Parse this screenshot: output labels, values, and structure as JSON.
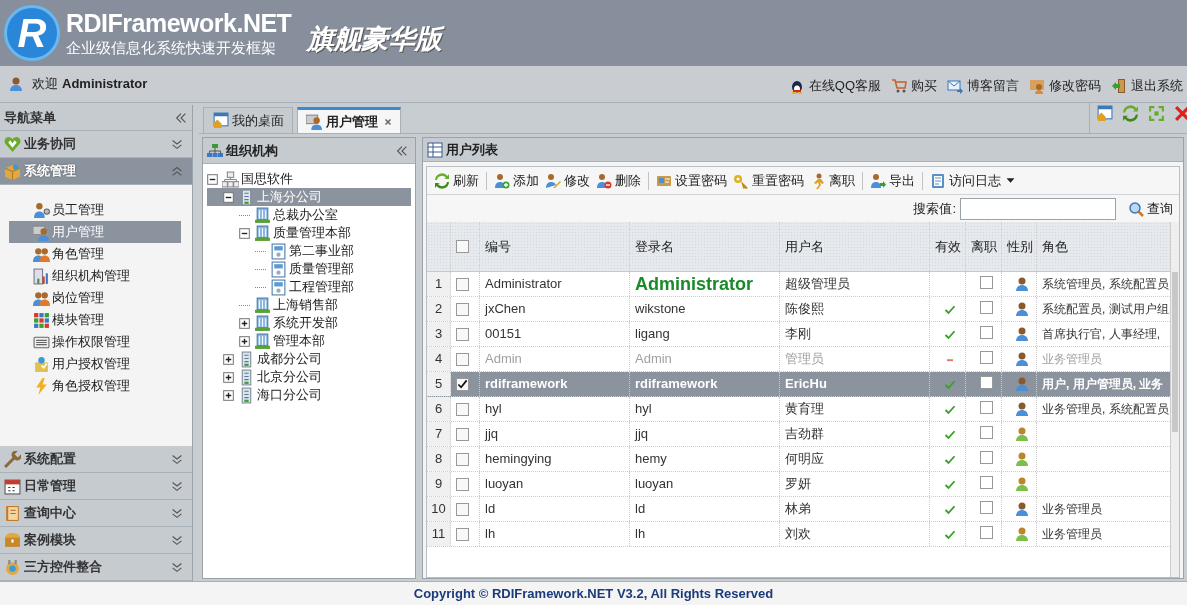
{
  "header": {
    "logo_letter": "R",
    "title": "RDIFramework.NET",
    "subtitle": "企业级信息化系统快速开发框架",
    "edition": "旗舰豪华版"
  },
  "user_bar": {
    "welcome": "欢迎",
    "user": "Administrator",
    "links": [
      "在线QQ客服",
      "购买",
      "博客留言",
      "修改密码",
      "退出系统"
    ]
  },
  "nav": {
    "title": "导航菜单",
    "sections": [
      {
        "label": "业务协同",
        "expanded": false
      },
      {
        "label": "系统管理",
        "expanded": true,
        "items": [
          {
            "label": "员工管理",
            "selected": false
          },
          {
            "label": "用户管理",
            "selected": true
          },
          {
            "label": "角色管理",
            "selected": false
          },
          {
            "label": "组织机构管理",
            "selected": false
          },
          {
            "label": "岗位管理",
            "selected": false
          },
          {
            "label": "模块管理",
            "selected": false
          },
          {
            "label": "操作权限管理",
            "selected": false
          },
          {
            "label": "用户授权管理",
            "selected": false
          },
          {
            "label": "角色授权管理",
            "selected": false
          }
        ]
      },
      {
        "label": "系统配置",
        "expanded": false
      },
      {
        "label": "日常管理",
        "expanded": false
      },
      {
        "label": "查询中心",
        "expanded": false
      },
      {
        "label": "案例模块",
        "expanded": false
      },
      {
        "label": "三方控件整合",
        "expanded": false
      }
    ]
  },
  "tabs": [
    {
      "label": "我的桌面",
      "selected": false,
      "closable": false
    },
    {
      "label": "用户管理",
      "selected": true,
      "closable": true
    }
  ],
  "org_panel": {
    "title": "组织机构",
    "tree": [
      {
        "label": "国思软件",
        "kind": "root",
        "expanded": true,
        "selected": false,
        "children": [
          {
            "label": "上海分公司",
            "kind": "company",
            "expanded": true,
            "selected": true,
            "children": [
              {
                "label": "总裁办公室",
                "kind": "dept",
                "selected": false
              },
              {
                "label": "质量管理本部",
                "kind": "dept",
                "expanded": true,
                "selected": false,
                "children": [
                  {
                    "label": "第二事业部",
                    "kind": "unit",
                    "selected": false
                  },
                  {
                    "label": "质量管理部",
                    "kind": "unit",
                    "selected": false
                  },
                  {
                    "label": "工程管理部",
                    "kind": "unit",
                    "selected": false
                  }
                ]
              },
              {
                "label": "上海销售部",
                "kind": "dept",
                "selected": false
              },
              {
                "label": "系统开发部",
                "kind": "dept",
                "expanded": false,
                "selected": false
              },
              {
                "label": "管理本部",
                "kind": "dept",
                "expanded": false,
                "selected": false
              }
            ]
          },
          {
            "label": "成都分公司",
            "kind": "company",
            "expanded": false,
            "selected": false
          },
          {
            "label": "北京分公司",
            "kind": "company",
            "expanded": false,
            "selected": false
          },
          {
            "label": "海口分公司",
            "kind": "company",
            "expanded": false,
            "selected": false
          }
        ]
      }
    ]
  },
  "user_panel": {
    "title": "用户列表",
    "toolbar": [
      [
        {
          "label": "刷新"
        }
      ],
      [
        {
          "label": "添加"
        },
        {
          "label": "修改"
        },
        {
          "label": "删除"
        }
      ],
      [
        {
          "label": "设置密码"
        },
        {
          "label": "重置密码"
        },
        {
          "label": "离职"
        }
      ],
      [
        {
          "label": "导出"
        }
      ],
      [
        {
          "label": "访问日志",
          "has_menu": true
        }
      ]
    ],
    "search": {
      "label": "搜索值:",
      "button": "查询"
    },
    "columns": [
      "编号",
      "登录名",
      "用户名",
      "有效",
      "离职",
      "性别",
      "角色"
    ],
    "header_checked": false,
    "rows": [
      {
        "num": "1",
        "code": "Administrator",
        "login": "Administrator",
        "name": "超级管理员",
        "resigned": false,
        "female": false,
        "roles": "系统管理员, 系统配置员",
        "selected": false,
        "disabled": false,
        "emphasized": true
      },
      {
        "num": "2",
        "code": "jxChen",
        "login": "wikstone",
        "name": "陈俊熙",
        "valid": true,
        "resigned": false,
        "female": false,
        "roles": "系统配置员, 测试用户组,",
        "selected": false,
        "disabled": false,
        "emphasized": false
      },
      {
        "num": "3",
        "code": "00151",
        "login": "ligang",
        "name": "李刚",
        "valid": true,
        "resigned": false,
        "female": false,
        "roles": "首席执行官, 人事经理,",
        "selected": false,
        "disabled": false,
        "emphasized": false
      },
      {
        "num": "4",
        "code": "Admin",
        "login": "Admin",
        "name": "管理员",
        "valid": false,
        "resigned": false,
        "female": false,
        "roles": "业务管理员",
        "selected": false,
        "disabled": true,
        "emphasized": false
      },
      {
        "num": "5",
        "code": "rdiframework",
        "login": "rdiframework",
        "name": "EricHu",
        "valid": true,
        "resigned": false,
        "female": false,
        "roles": "用户, 用户管理员, 业务",
        "selected": true,
        "disabled": false,
        "emphasized": false
      },
      {
        "num": "6",
        "code": "hyl",
        "login": "hyl",
        "name": "黄育理",
        "valid": true,
        "resigned": false,
        "female": false,
        "roles": "业务管理员, 系统配置员",
        "selected": false,
        "disabled": false,
        "emphasized": false
      },
      {
        "num": "7",
        "code": "jjq",
        "login": "jjq",
        "name": "吉劲群",
        "valid": true,
        "resigned": false,
        "female": true,
        "selected": false,
        "disabled": false,
        "emphasized": false
      },
      {
        "num": "8",
        "code": "hemingying",
        "login": "hemy",
        "name": "何明应",
        "valid": true,
        "resigned": false,
        "female": true,
        "selected": false,
        "disabled": false,
        "emphasized": false
      },
      {
        "num": "9",
        "code": "luoyan",
        "login": "luoyan",
        "name": "罗妍",
        "valid": true,
        "resigned": false,
        "female": true,
        "selected": false,
        "disabled": false,
        "emphasized": false
      },
      {
        "num": "10",
        "code": "ld",
        "login": "ld",
        "name": "林弟",
        "valid": true,
        "resigned": false,
        "female": false,
        "roles": "业务管理员",
        "selected": false,
        "disabled": false,
        "emphasized": false
      },
      {
        "num": "11",
        "code": "lh",
        "login": "lh",
        "name": "刘欢",
        "valid": true,
        "resigned": false,
        "female": true,
        "roles": "业务管理员",
        "selected": false,
        "disabled": false,
        "emphasized": false
      }
    ]
  },
  "footer": "Copyright © RDIFramework.NET V3.2, All Rights Reserved"
}
